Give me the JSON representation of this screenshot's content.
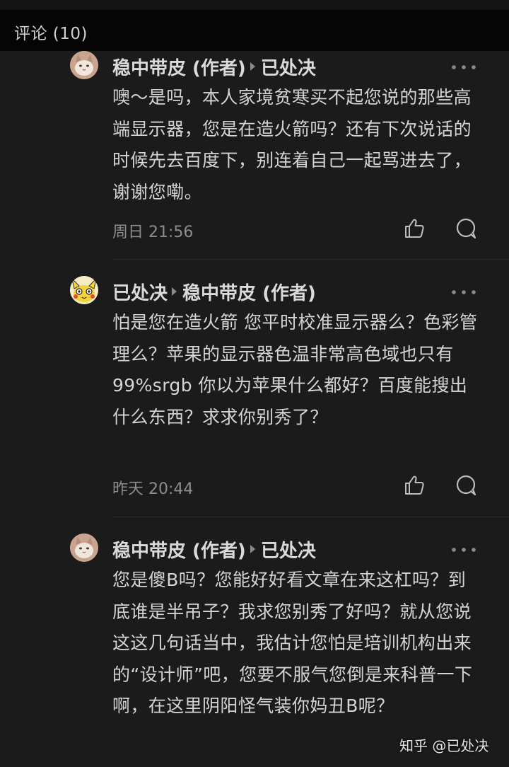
{
  "header": {
    "title": "评论 (10)"
  },
  "comments": [
    {
      "author": "稳中带皮 (作者)",
      "reply_to": "已处决",
      "avatar_icon": "cat-avatar-icon",
      "text": "噢～是吗，本人家境贫寒买不起您说的那些高端显示器，您是在造火箭吗？还有下次说话的时候先去百度下，别连着自己一起骂进去了，谢谢您嘞。",
      "time": "周日 21:56"
    },
    {
      "author": "已处决",
      "reply_to": "稳中带皮 (作者)",
      "avatar_icon": "pikachu-avatar-icon",
      "text": "怕是您在造火箭 您平时校准显示器么？色彩管理么？苹果的显示器色温非常高色域也只有99%srgb 你以为苹果什么都好？百度能搜出什么东西？求求你别秀了？",
      "time": "昨天 20:44"
    },
    {
      "author": "稳中带皮 (作者)",
      "reply_to": "已处决",
      "avatar_icon": "cat-avatar-icon",
      "text": "您是傻B吗？您能好好看文章在来这杠吗？到底谁是半吊子？我求您别秀了好吗？就从您说这这几句话当中，我估计您怕是培训机构出来的“设计师”吧，您要不服气您倒是来科普一下啊，在这里阴阳怪气装你妈丑B呢？"
    }
  ],
  "watermark": "知乎 @已处决",
  "colors": {
    "background": "#1b1b1b",
    "header_bg": "#050505",
    "text": "#d4d4d4",
    "muted": "#8c8c8c"
  }
}
